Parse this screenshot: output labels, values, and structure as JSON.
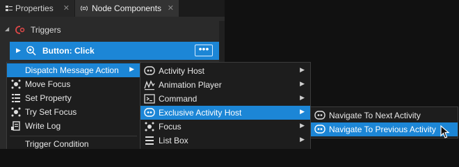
{
  "tabs": [
    {
      "label": "Properties",
      "close": "✕"
    },
    {
      "label": "Node Components",
      "close": "✕"
    }
  ],
  "section": {
    "label": "Triggers",
    "expander": "◢"
  },
  "trigger": {
    "label": "Button: Click",
    "more": "•••",
    "expander": "▶"
  },
  "menu1": {
    "items": [
      {
        "label": "Dispatch Message Action",
        "arrow": "▶"
      },
      {
        "label": "Move Focus"
      },
      {
        "label": "Set Property"
      },
      {
        "label": "Try Set Focus"
      },
      {
        "label": "Write Log"
      },
      {
        "label": "Trigger Condition"
      }
    ]
  },
  "menu2": {
    "items": [
      {
        "label": "Activity Host",
        "arrow": "▶"
      },
      {
        "label": "Animation Player",
        "arrow": "▶"
      },
      {
        "label": "Command",
        "arrow": "▶"
      },
      {
        "label": "Exclusive Activity Host",
        "arrow": "▶"
      },
      {
        "label": "Focus",
        "arrow": "▶"
      },
      {
        "label": "List Box",
        "arrow": "▶"
      }
    ]
  },
  "menu3": {
    "items": [
      {
        "label": "Navigate To Next Activity"
      },
      {
        "label": "Navigate To Previous Activity"
      }
    ]
  },
  "colors": {
    "accent": "#1c86d6",
    "menu_bg": "#1d1d1d",
    "panel_bg": "#2a2a2a"
  }
}
